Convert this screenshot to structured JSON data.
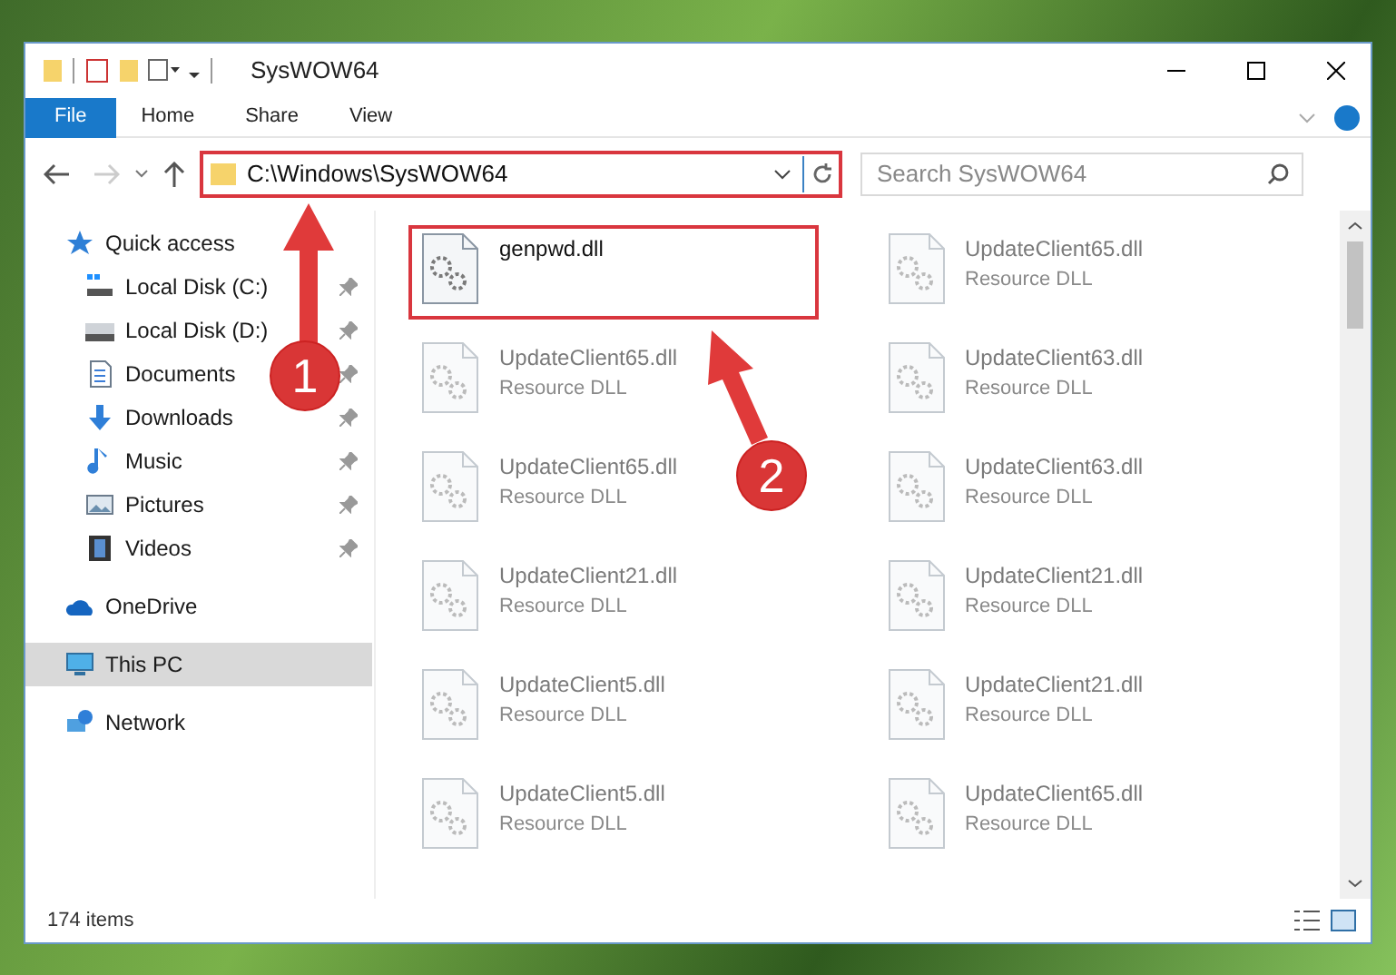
{
  "window": {
    "title": "SysWOW64"
  },
  "ribbon_tabs": [
    {
      "label": "File",
      "selected": true
    },
    {
      "label": "Home",
      "selected": false
    },
    {
      "label": "Share",
      "selected": false
    },
    {
      "label": "View",
      "selected": false
    }
  ],
  "address": {
    "value": "C:\\Windows\\SysWOW64",
    "highlighted": true
  },
  "search": {
    "placeholder": "Search SysWOW64"
  },
  "sidebar": {
    "items": [
      {
        "label": "Quick access",
        "kind": "star",
        "selected": false,
        "children": [
          {
            "label": "Local Disk (C:)",
            "kind": "windisk",
            "selected": false
          },
          {
            "label": "Local Disk (D:)",
            "kind": "disk",
            "selected": false
          },
          {
            "label": "Documents",
            "kind": "doc",
            "selected": false
          },
          {
            "label": "Downloads",
            "kind": "download",
            "selected": false
          },
          {
            "label": "Music",
            "kind": "music",
            "selected": false
          },
          {
            "label": "Pictures",
            "kind": "picture",
            "selected": false
          },
          {
            "label": "Videos",
            "kind": "video",
            "selected": false
          }
        ]
      },
      {
        "label": "OneDrive",
        "kind": "cloud",
        "selected": false
      },
      {
        "label": "This PC",
        "kind": "pc",
        "selected": true
      },
      {
        "label": "Network",
        "kind": "network",
        "selected": false
      }
    ]
  },
  "files": [
    {
      "name": "genpwd.dll",
      "highlighted": true,
      "blurred": false
    },
    {
      "name": "UpdateClient65.dll",
      "type": "Resource DLL",
      "highlighted": false,
      "blurred": true
    },
    {
      "name": "UpdateClient65.dll",
      "type": "Resource DLL",
      "highlighted": false,
      "blurred": true
    },
    {
      "name": "UpdateClient63.dll",
      "type": "Resource DLL",
      "highlighted": false,
      "blurred": true
    },
    {
      "name": "UpdateClient65.dll",
      "type": "Resource DLL",
      "highlighted": false,
      "blurred": true
    },
    {
      "name": "UpdateClient63.dll",
      "type": "Resource DLL",
      "highlighted": false,
      "blurred": true
    },
    {
      "name": "UpdateClient21.dll",
      "type": "Resource DLL",
      "highlighted": false,
      "blurred": true
    },
    {
      "name": "UpdateClient21.dll",
      "type": "Resource DLL",
      "highlighted": false,
      "blurred": true
    },
    {
      "name": "UpdateClient5.dll",
      "type": "Resource DLL",
      "highlighted": false,
      "blurred": true
    },
    {
      "name": "UpdateClient21.dll",
      "type": "Resource DLL",
      "highlighted": false,
      "blurred": true
    },
    {
      "name": "UpdateClient5.dll",
      "type": "Resource DLL",
      "highlighted": false,
      "blurred": true
    },
    {
      "name": "UpdateClient65.dll",
      "type": "Resource DLL",
      "highlighted": false,
      "blurred": true
    }
  ],
  "status_bar": {
    "count": "174 items"
  },
  "annotations": [
    {
      "number": "1"
    },
    {
      "number": "2"
    }
  ]
}
